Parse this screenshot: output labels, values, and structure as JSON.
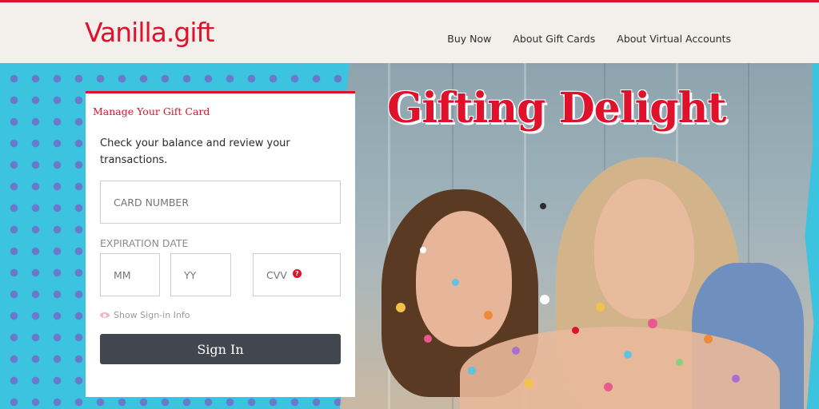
{
  "brand": {
    "logo_text": "Vanilla.gift",
    "accent": "#e0112b"
  },
  "nav": {
    "items": [
      "Buy Now",
      "About Gift Cards",
      "About Virtual Accounts"
    ]
  },
  "hero": {
    "headline": "Gifting Delight"
  },
  "form": {
    "title": "Manage Your Gift Card",
    "description": "Check your balance and review your transactions.",
    "card_number_placeholder": "CARD NUMBER",
    "expiration_label": "EXPIRATION DATE",
    "mm_placeholder": "MM",
    "yy_placeholder": "YY",
    "cvv_placeholder": "CVV",
    "help_glyph": "?",
    "show_info_label": "Show Sign-in Info",
    "sign_in_label": "Sign In"
  },
  "icons": [
    "eye-icon",
    "help-icon"
  ]
}
